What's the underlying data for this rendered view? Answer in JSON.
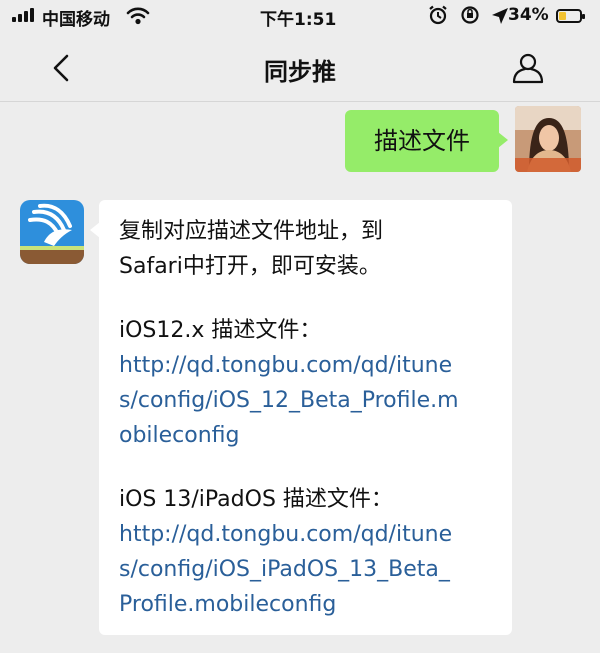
{
  "status_bar": {
    "carrier": "中国移动",
    "time": "下午1:51",
    "battery_percent": "34%",
    "battery_level": 0.34,
    "icons": [
      "signal-icon",
      "wifi-icon",
      "alarm-icon",
      "orientation-lock-icon",
      "location-arrow-icon",
      "battery-charging-icon"
    ]
  },
  "nav": {
    "title": "同步推",
    "back_icon": "chevron-left-icon",
    "profile_icon": "person-icon"
  },
  "messages": {
    "outgoing": {
      "text": "描述文件"
    },
    "incoming": {
      "lines": [
        "复制对应描述文件地址，到",
        "Safari中打开，即可安装。",
        "iOS12.x 描述文件：",
        "iOS 13/iPadOS 描述文件："
      ],
      "links": [
        [
          "http://qd.tongbu.com/qd/itune",
          "s/config/iOS_12_Beta_Profile.m",
          "obileconfig"
        ],
        [
          "http://qd.tongbu.com/qd/itune",
          "s/config/iOS_iPadOS_13_Beta_",
          "Profile.mobileconfig"
        ]
      ]
    }
  },
  "colors": {
    "background": "#ededed",
    "outgoing_bubble": "#95ec69",
    "incoming_bubble": "#ffffff",
    "link": "#2a5f99",
    "app_icon_blue": "#2e8fdc"
  }
}
